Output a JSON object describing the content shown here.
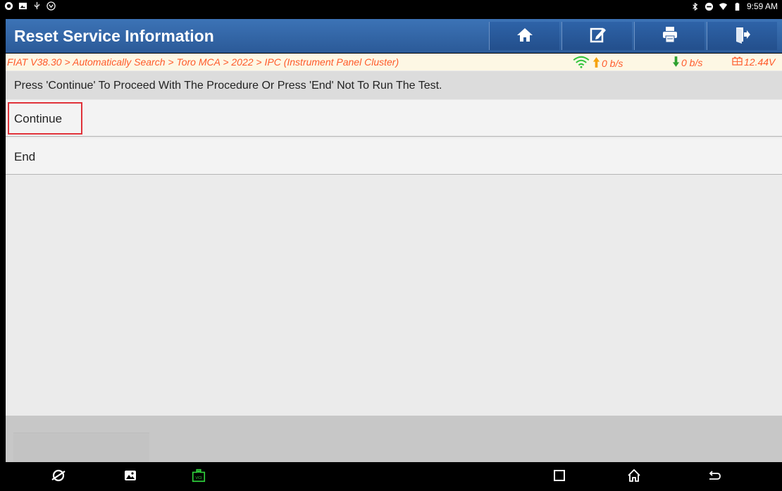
{
  "status_bar": {
    "left_icons": [
      "browser-icon",
      "image-icon",
      "usb-icon",
      "assistant-icon"
    ],
    "right_icons": [
      "bluetooth-icon",
      "dnd-icon",
      "wifi-icon",
      "battery-icon"
    ],
    "time": "9:59 AM"
  },
  "title": "Reset Service Information",
  "toolbar": {
    "buttons": [
      "home-icon",
      "edit-icon",
      "print-icon",
      "exit-icon"
    ]
  },
  "breadcrumb": {
    "path": "FIAT V38.30 > Automatically Search > Toro MCA > 2022 > IPC (Instrument Panel Cluster)",
    "upload_rate": "0 b/s",
    "download_rate": "0 b/s",
    "voltage": "12.44V"
  },
  "instruction": "Press 'Continue' To Proceed With The Procedure Or Press 'End' Not To Run The Test.",
  "options": [
    {
      "label": "Continue",
      "highlighted": true
    },
    {
      "label": "End",
      "highlighted": false
    }
  ],
  "nav_bar": {
    "left": [
      "browser-icon",
      "gallery-icon",
      "vci-icon"
    ],
    "right": [
      "recents-icon",
      "home-icon",
      "back-icon"
    ],
    "vci_label": "VCI"
  },
  "colors": {
    "title_bar": "#2f62a6",
    "breadcrumb_text": "#ff5a2a",
    "breadcrumb_bg": "#fdf7e4",
    "highlight": "#e0323a",
    "up_arrow": "#f5a20a",
    "down_arrow": "#2fa12f",
    "wifi": "#31c43a",
    "vci": "#2fd13c"
  }
}
